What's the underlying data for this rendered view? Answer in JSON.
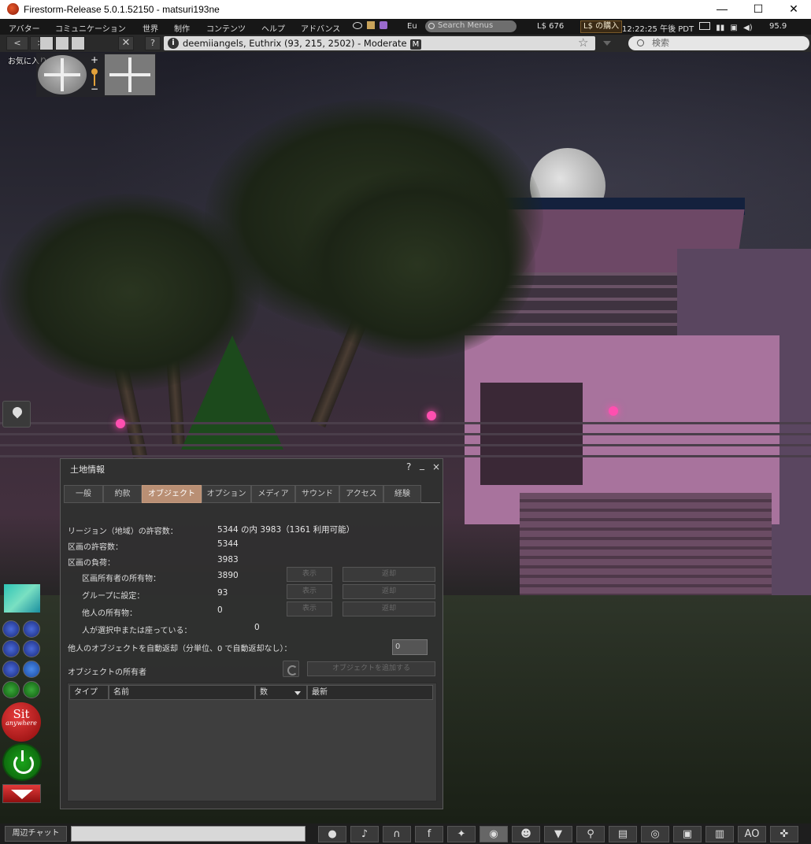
{
  "window": {
    "title": "Firestorm-Release 5.0.1.52150 - matsuri193ne",
    "min": "—",
    "max": "☐",
    "close": "✕"
  },
  "menubar": {
    "items": [
      "アバター",
      "コミュニケーション",
      "世界",
      "制作",
      "コンテンツ",
      "ヘルプ",
      "アドバンス"
    ],
    "eu_label": "Eu",
    "search_placeholder": "Search Menus",
    "balance": "L$ 676",
    "buy_label": "L$ の購入",
    "time": "12:22:25 午後 PDT",
    "fps": "95.9"
  },
  "navbar": {
    "location": "deemiiangels, Euthrix (93, 215, 2502) - Moderate",
    "maturity_badge": "M",
    "search_placeholder": "検索",
    "star": "☆"
  },
  "hud": {
    "favorites_label": "お気に入りバー",
    "zoom_plus": "+",
    "zoom_minus": "−",
    "sit_line1": "Sit",
    "sit_line2": "anywhere"
  },
  "floater": {
    "title": "土地情報",
    "help": "?",
    "minimize": "_",
    "close": "×",
    "tabs": [
      "一般",
      "約款",
      "オブジェクト",
      "オプション",
      "メディア",
      "サウンド",
      "アクセス",
      "経験"
    ],
    "active_tab": "オブジェクト",
    "region_label": "リージョン（地域）の許容数：",
    "region_value": "5344 の内 3983（1361 利用可能）",
    "parcel_capacity_label": "区画の許容数：",
    "parcel_capacity_value": "5344",
    "parcel_load_label": "区画の負荷：",
    "parcel_load_value": "3983",
    "owner_objects_label": "区画所有者の所有物：",
    "owner_objects_value": "3890",
    "group_objects_label": "グループに設定：",
    "group_objects_value": "93",
    "other_objects_label": "他人の所有物：",
    "other_objects_value": "0",
    "sitting_label": "人が選択中または座っている：",
    "sitting_value": "0",
    "show_label": "表示",
    "return_label": "返却",
    "autoreturn_label": "他人のオブジェクトを自動返却（分単位、0 で自動返却なし）：",
    "autoreturn_value": "0",
    "owners_label": "オブジェクトの所有者",
    "add_objects_label": "オブジェクトを追加する",
    "table_headers": [
      "タイプ",
      "名前",
      "数",
      "最新"
    ]
  },
  "bottombar": {
    "chat_button": "周辺チャット",
    "ao_label": "AO"
  },
  "colors": {
    "active_tab": "#b98f74",
    "panel_bg": "#303030",
    "lamp_pink": "#ff4fb0"
  }
}
